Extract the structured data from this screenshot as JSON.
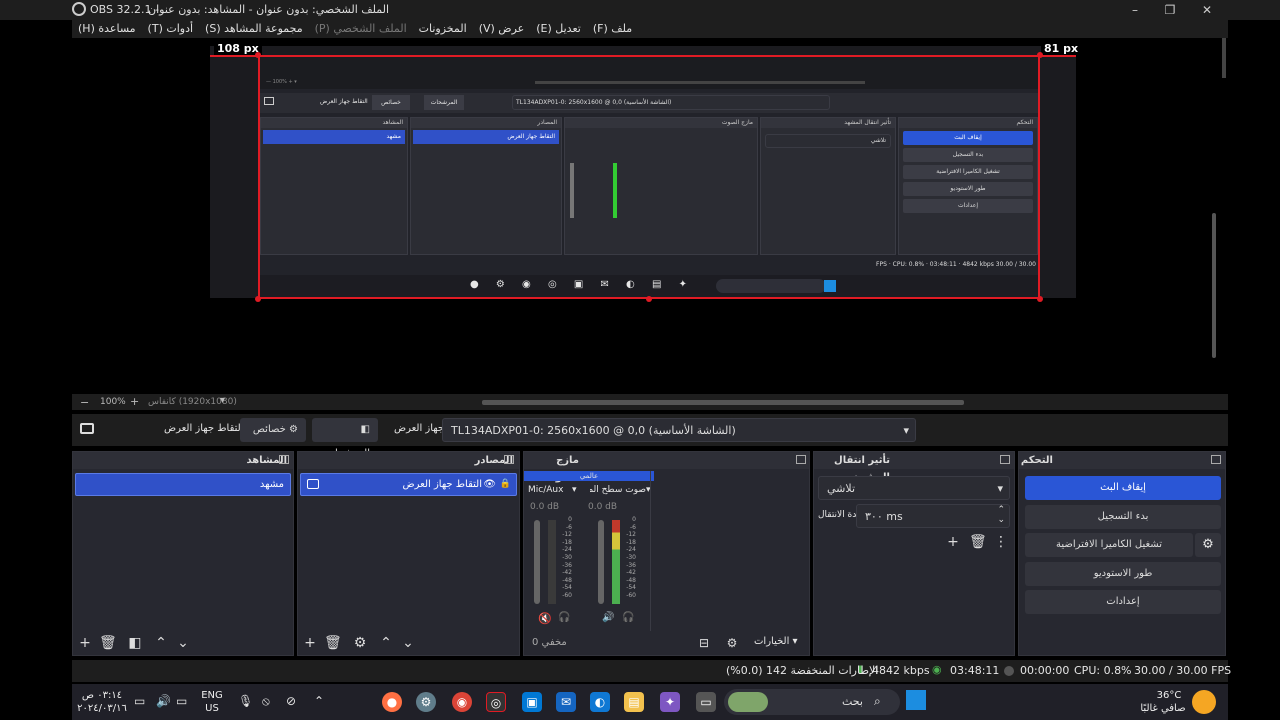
{
  "window": {
    "title": "OBS 32.2.1 - الملف الشخصي: بدون عنوان - المشاهد: بدون عنوان",
    "title_rtl": "الملف الشخصي: بدون عنوان - المشاهد: بدون عنوان",
    "app_version": "OBS 32.2.1 -",
    "controls": [
      "–",
      "❐",
      "✕"
    ]
  },
  "menubar": {
    "items": [
      {
        "label": "ملف (F)",
        "enabled": true
      },
      {
        "label": "تعديل (E)",
        "enabled": true
      },
      {
        "label": "عرض (V)",
        "enabled": true
      },
      {
        "label": "المخزونات",
        "enabled": true
      },
      {
        "label": "الملف الشخصي (P)",
        "enabled": false
      },
      {
        "label": "مجموعة المشاهد (S)",
        "enabled": true
      },
      {
        "label": "أدوات (T)",
        "enabled": true
      },
      {
        "label": "مساعدة (H)",
        "enabled": true
      }
    ]
  },
  "preview": {
    "crop_left_label": "108 px",
    "crop_right_label": "81 px",
    "zoom_minus": "−",
    "zoom_value": "100%",
    "zoom_plus": "+",
    "canvas_label": "كانفاس (1920x1080)"
  },
  "source_toolbar": {
    "source_name": "التقاط جهاز العرض",
    "properties_label": "خصائص",
    "filters_label": "المرشحات",
    "display_label": "جهاز العرض",
    "display_value": "TL134ADXP01-0: 2560x1600 @ 0,0 (الشاشة الأساسية)"
  },
  "docks": {
    "scenes": {
      "title": "المشاهد",
      "items": [
        "مشهد"
      ]
    },
    "sources": {
      "title": "المصادر",
      "items": [
        "التقاط جهاز العرض"
      ]
    },
    "audio_mixer": {
      "title": "مازج الصوت",
      "header_label": "عالمي",
      "channels": [
        {
          "name": "Mic/Aux",
          "db": "0.0 dB",
          "muted": true,
          "level": 0.0
        },
        {
          "name": "صوت سطح المكتب",
          "db": "0.0 dB",
          "muted": false,
          "level": 0.55
        }
      ],
      "scale": [
        "0",
        "-6",
        "-12",
        "-18",
        "-24",
        "-30",
        "-36",
        "-42",
        "-48",
        "-54",
        "-60"
      ],
      "footer_label": "مخفي 0",
      "options_label": "الخيارات"
    },
    "transitions": {
      "title": "تأثير انتقال المشهد",
      "type": "تلاشي",
      "duration_label": "مدة الانتقال",
      "duration_value": "٣٠٠ ms"
    },
    "controls": {
      "title": "التحكم",
      "buttons": {
        "stop_stream": "إيقاف البث",
        "start_recording": "بدء التسجيل",
        "virtual_camera": "تشغيل الكاميرا الافتراضية",
        "studio_mode": "طور الاستوديو",
        "settings": "إعدادات"
      }
    }
  },
  "status": {
    "dropped_frames": "الإطارات المنخفضة 142 (0.0%)",
    "bitrate": "4842 kbps",
    "stream_time": "03:48:11",
    "rec_time": "00:00:00",
    "cpu": "CPU: 0.8%",
    "fps": "30.00 / 30.00 FPS"
  },
  "taskbar": {
    "weather_temp": "36°C",
    "weather_desc": "صافي غالبًا",
    "search_label": "بحث",
    "lang_top": "ENG",
    "lang_bottom": "US",
    "time": "٠٣:١٤ ص",
    "date": "٢٠٢٤/٠٣/١٦"
  },
  "colors": {
    "accent": "#2a56d6",
    "selection": "#3051c8",
    "crop_border": "#e01b24",
    "status_green": "#4caf50"
  }
}
